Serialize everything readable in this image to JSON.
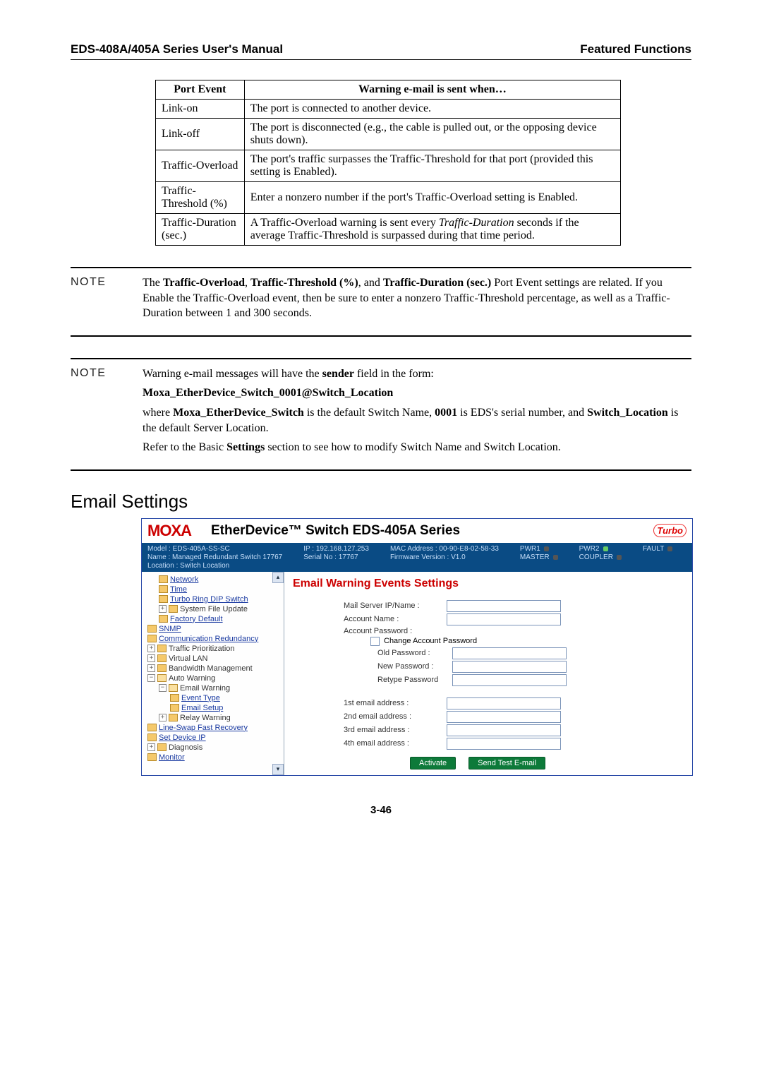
{
  "header": {
    "left": "EDS-408A/405A Series User's Manual",
    "right": "Featured Functions"
  },
  "port_event_table": {
    "col1": "Port Event",
    "col2": "Warning e-mail is sent when…",
    "rows": [
      {
        "c1": "Link-on",
        "c2": "The port is connected to another device."
      },
      {
        "c1": "Link-off",
        "c2": "The port is disconnected (e.g., the cable is pulled out, or the opposing device shuts down)."
      },
      {
        "c1": "Traffic-Overload",
        "c2": "The port's traffic surpasses the Traffic-Threshold for that port (provided this setting is Enabled)."
      },
      {
        "c1": "Traffic-Threshold (%)",
        "c2": "Enter a nonzero number if the port's Traffic-Overload setting is Enabled."
      },
      {
        "c1": "Traffic-Duration (sec.)",
        "c2_pre": "A Traffic-Overload warning is sent every ",
        "c2_it": "Traffic-Duration",
        "c2_post": " seconds if the average Traffic-Threshold is surpassed during that time period."
      }
    ]
  },
  "note1": {
    "label": "NOTE",
    "p1a": "The ",
    "p1b": "Traffic-Overload",
    "p1c": ", ",
    "p1d": "Traffic-Threshold (%)",
    "p1e": ", and ",
    "p1f": "Traffic-Duration (sec.)",
    "p1g": " Port Event settings are related. If you Enable the Traffic-Overload event, then be sure to enter a nonzero Traffic-Threshold percentage, as well as a Traffic-Duration between 1 and 300 seconds."
  },
  "note2": {
    "label": "NOTE",
    "l1a": "Warning e-mail messages will have the ",
    "l1b": "sender",
    "l1c": " field in the form:",
    "l2": "Moxa_EtherDevice_Switch_0001@Switch_Location",
    "l3a": "where ",
    "l3b": "Moxa_EtherDevice_Switch",
    "l3c": " is the default Switch Name, ",
    "l3d": "0001",
    "l3e": " is EDS's serial number, and ",
    "l3f": "Switch_Location",
    "l3g": " is the default Server Location.",
    "l4a": "Refer to the Basic ",
    "l4b": "Settings",
    "l4c": " section to see how to modify Switch Name and Switch Location."
  },
  "section_heading": "Email Settings",
  "ss": {
    "logo": "MOXA",
    "product": "EtherDevice™ Switch EDS-405A Series",
    "turbo": "Turbo",
    "status": {
      "model_l": "Model :",
      "model_v": "EDS-405A-SS-SC",
      "name_l": "Name :",
      "name_v": "Managed Redundant Switch 17767",
      "loc_l": "Location :",
      "loc_v": "Switch Location",
      "ip_l": "IP :",
      "ip_v": "192.168.127.253",
      "serial_l": "Serial No :",
      "serial_v": "17767",
      "mac_l": "MAC Address :",
      "mac_v": "00-90-E8-02-58-33",
      "fw_l": "Firmware Version :",
      "fw_v": "V1.0",
      "pwr1": "PWR1",
      "master": "MASTER",
      "pwr2": "PWR2",
      "coupler": "COUPLER",
      "fault": "FAULT"
    },
    "tree": {
      "network": "Network",
      "time": "Time",
      "trds": "Turbo Ring DIP Switch",
      "sfu": "System File Update",
      "fd": "Factory Default",
      "snmp": "SNMP",
      "cr": "Communication Redundancy",
      "tp": "Traffic Prioritization",
      "vlan": "Virtual LAN",
      "bm": "Bandwidth Management",
      "aw": "Auto Warning",
      "ew": "Email Warning",
      "et": "Event Type",
      "es": "Email Setup",
      "rw": "Relay Warning",
      "lsfr": "Line-Swap Fast Recovery",
      "sdi": "Set Device IP",
      "diag": "Diagnosis",
      "mon": "Monitor"
    },
    "form": {
      "title": "Email Warning Events Settings",
      "mail_server": "Mail Server IP/Name :",
      "acct_name": "Account Name :",
      "acct_pw": "Account Password :",
      "change_pw": "Change Account Password",
      "old_pw": "Old Password :",
      "new_pw": "New Password :",
      "retype_pw": "Retype Password",
      "e1": "1st email address :",
      "e2": "2nd email address :",
      "e3": "3rd email address :",
      "e4": "4th email address :",
      "activate": "Activate",
      "sendtest": "Send Test E-mail"
    }
  },
  "page_number": "3-46"
}
